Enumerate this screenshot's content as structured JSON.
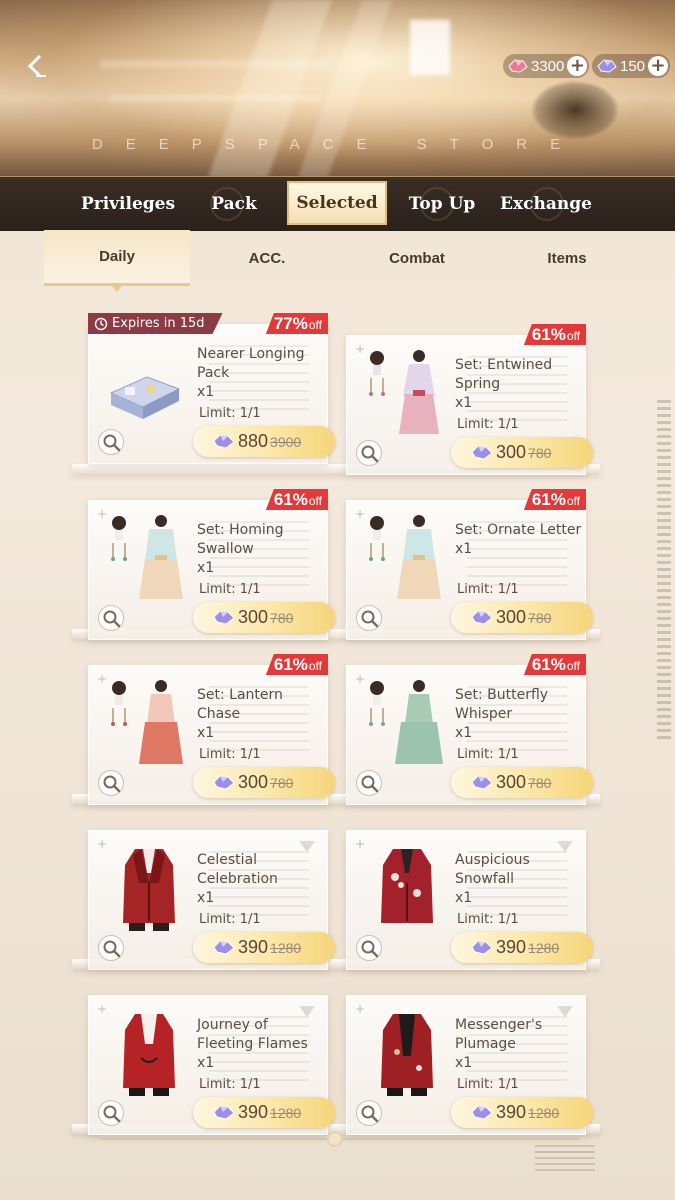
{
  "header": {
    "store_title": "DEEPSPACE STORE",
    "currencies": [
      {
        "icon": "red-crystal-icon",
        "amount": "3300"
      },
      {
        "icon": "purple-crystal-icon",
        "amount": "150"
      }
    ]
  },
  "tabs": [
    "Privileges",
    "Pack",
    "Selected",
    "Top Up",
    "Exchange"
  ],
  "active_tab": "Selected",
  "subtabs": [
    "Daily",
    "ACC.",
    "Combat",
    "Items"
  ],
  "active_subtab": "Daily",
  "expire_label": "Expires in 15d",
  "off_label": "off",
  "limit_label": "Limit: 1/1",
  "qty_label": "x1",
  "items": [
    {
      "name": "Nearer Longing Pack",
      "discount": "77%",
      "price": "880",
      "original": "3900"
    },
    {
      "name": "Set: Entwined Spring",
      "discount": "61%",
      "price": "300",
      "original": "780"
    },
    {
      "name": "Set: Homing Swallow",
      "discount": "61%",
      "price": "300",
      "original": "780"
    },
    {
      "name": "Set: Ornate Letter",
      "discount": "61%",
      "price": "300",
      "original": "780"
    },
    {
      "name": "Set: Lantern Chase",
      "discount": "61%",
      "price": "300",
      "original": "780"
    },
    {
      "name": "Set: Butterfly Whisper",
      "discount": "61%",
      "price": "300",
      "original": "780"
    },
    {
      "name": "Celestial Celebration",
      "price": "390",
      "original": "1280"
    },
    {
      "name": "Auspicious Snowfall",
      "price": "390",
      "original": "1280"
    },
    {
      "name": "Journey of Fleeting Flames",
      "price": "390",
      "original": "1280"
    },
    {
      "name": "Messenger's Plumage",
      "price": "390",
      "original": "1280"
    }
  ],
  "colors": {
    "discount_badge": "#e23a3a",
    "expire_badge": "#8c3a44",
    "price_button": "#f5d57a",
    "nav_bg": "#2a211b"
  }
}
